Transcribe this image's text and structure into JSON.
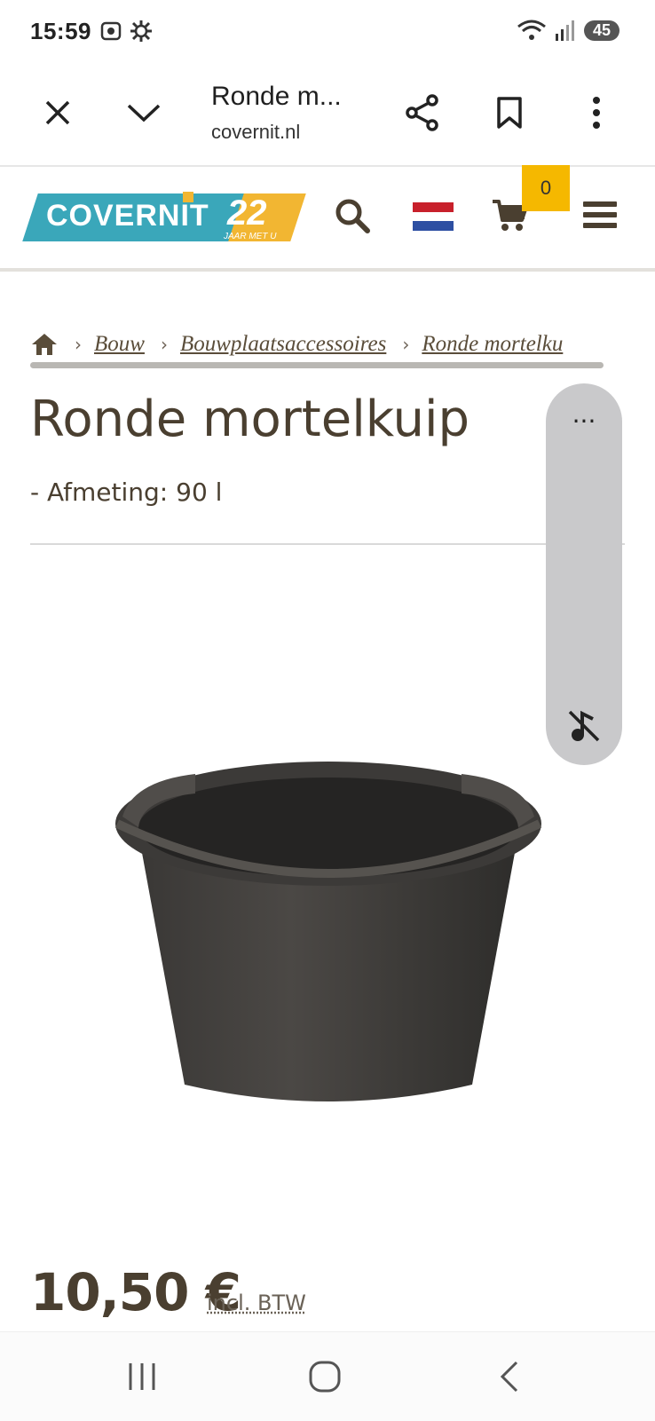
{
  "status_bar": {
    "time": "15:59",
    "battery": "45",
    "icons": [
      "screenshot-icon",
      "settings-gear-icon",
      "wifi-icon",
      "signal-icon"
    ]
  },
  "browser": {
    "tab_title": "Ronde m...",
    "url": "covernit.nl"
  },
  "site": {
    "logo_text": "COVERNIT",
    "logo_years": "22",
    "logo_tagline": "JAAR MET U",
    "cart_count": "0",
    "colors": {
      "brand_teal": "#3aa7ba",
      "brand_yellow": "#f2b632",
      "text_brown": "#4a3f30"
    }
  },
  "breadcrumb": {
    "items": [
      "Bouw",
      "Bouwplaatsaccessoires",
      "Ronde mortelku"
    ]
  },
  "product": {
    "title": "Ronde mortelkuip",
    "spec": "- Afmeting: 90 l",
    "price": "10,50 €",
    "price_note": "incl. BTW"
  },
  "floating_panel": {
    "more_label": "..."
  }
}
